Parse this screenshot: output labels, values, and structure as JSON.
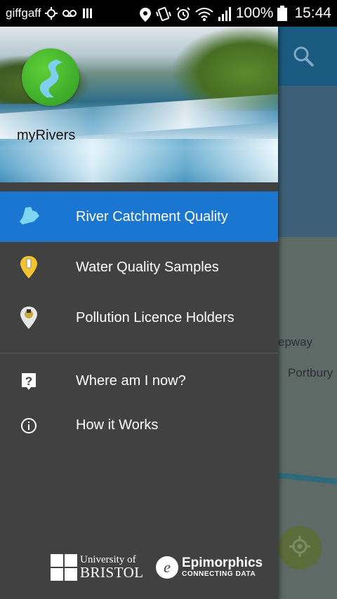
{
  "status_bar": {
    "carrier": "giffgaff",
    "battery": "100%",
    "time": "15:44",
    "icons": [
      "sync-icon",
      "voicemail-icon",
      "sim-bars-icon",
      "location-icon",
      "vibrate-icon",
      "alarm-icon",
      "wifi-icon",
      "signal-icon",
      "battery-icon"
    ]
  },
  "map": {
    "labels": [
      "epway",
      "Portbury"
    ],
    "search_icon": "search-icon",
    "locate_icon": "my-location-icon"
  },
  "drawer": {
    "app_name": "myRivers",
    "logo_icon": "river-logo-icon",
    "primary_items": [
      {
        "label": "River Catchment Quality",
        "icon": "catchment-icon",
        "active": true
      },
      {
        "label": "Water Quality Samples",
        "icon": "sample-marker-icon",
        "active": false
      },
      {
        "label": "Pollution Licence Holders",
        "icon": "licence-marker-icon",
        "active": false
      }
    ],
    "secondary_items": [
      {
        "label": "Where am I now?",
        "icon": "help-icon"
      },
      {
        "label": "How it Works",
        "icon": "info-icon"
      }
    ],
    "footer": {
      "university_line1": "University of",
      "university_line2": "BRISTOL",
      "epimorphics_name": "Epimorphics",
      "epimorphics_tagline": "CONNECTING DATA",
      "epimorphics_mark": "e"
    }
  },
  "colors": {
    "drawer_bg": "#414141",
    "active_item": "#1b76d2",
    "map_toolbar": "#1a5a80",
    "logo_green": "#3fae2a"
  }
}
